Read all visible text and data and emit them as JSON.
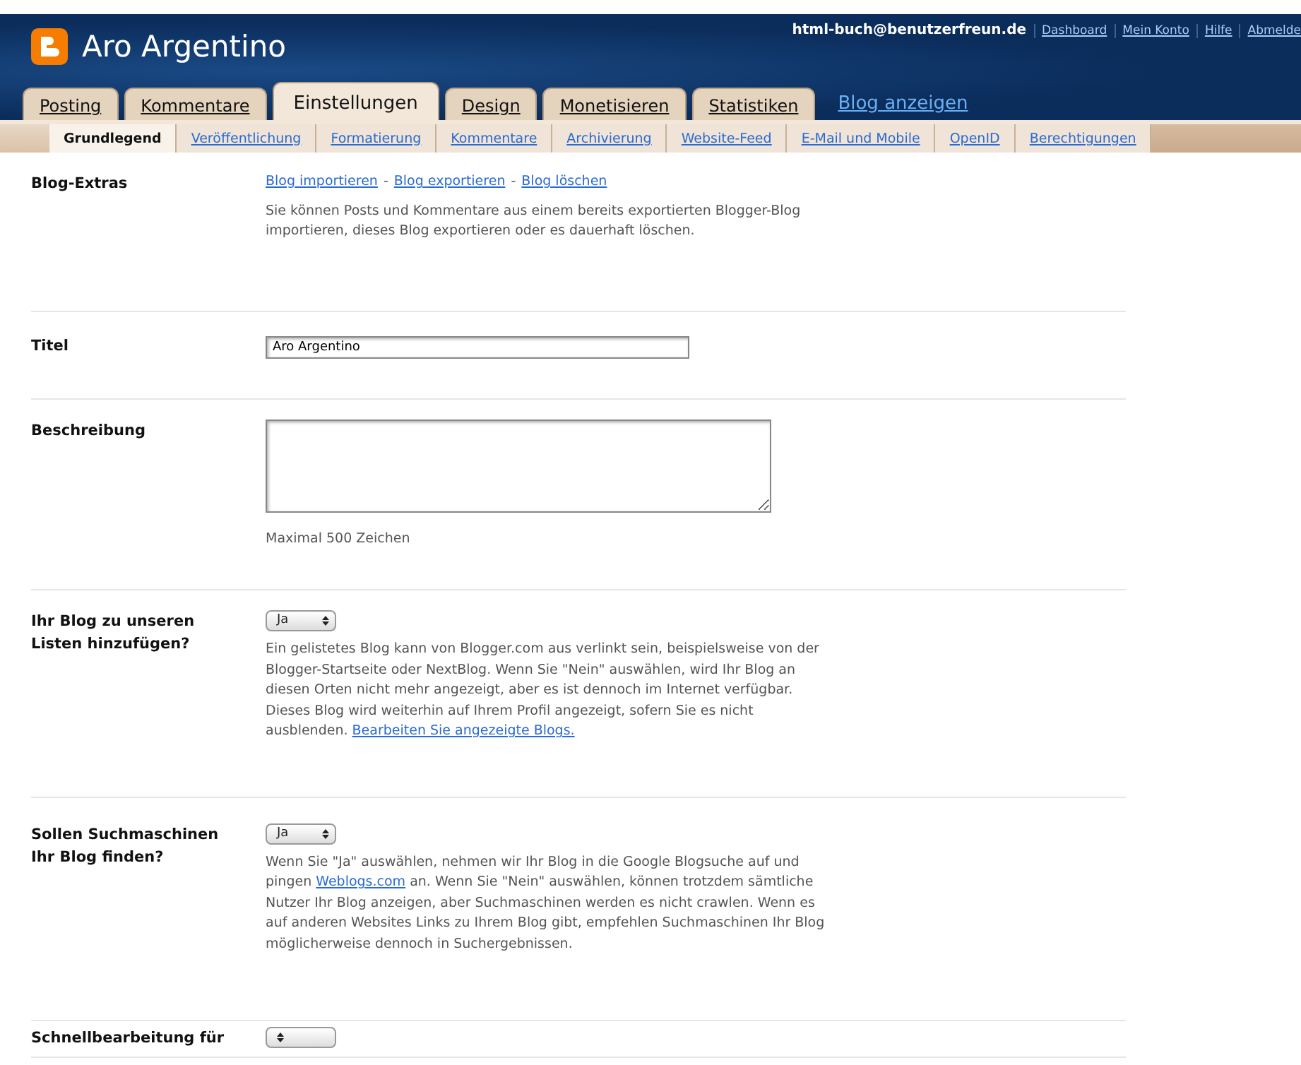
{
  "header": {
    "blog_title": "Aro Argentino",
    "user_email": "html-buch@benutzerfreun.de",
    "links": [
      "Dashboard",
      "Mein Konto",
      "Hilfe",
      "Abmelde"
    ]
  },
  "tabs": [
    {
      "label": "Posting",
      "selected": false
    },
    {
      "label": "Kommentare",
      "selected": false
    },
    {
      "label": "Einstellungen",
      "selected": true
    },
    {
      "label": "Design",
      "selected": false
    },
    {
      "label": "Monetisieren",
      "selected": false
    },
    {
      "label": "Statistiken",
      "selected": false
    }
  ],
  "view_blog_link": "Blog anzeigen",
  "subtabs": [
    {
      "label": "Grundlegend",
      "selected": true
    },
    {
      "label": "Veröffentlichung",
      "selected": false
    },
    {
      "label": "Formatierung",
      "selected": false
    },
    {
      "label": "Kommentare",
      "selected": false
    },
    {
      "label": "Archivierung",
      "selected": false
    },
    {
      "label": "Website-Feed",
      "selected": false
    },
    {
      "label": "E-Mail und Mobile",
      "selected": false
    },
    {
      "label": "OpenID",
      "selected": false
    },
    {
      "label": "Berechtigungen",
      "selected": false
    }
  ],
  "settings": [
    {
      "label": "Blog-Extras",
      "kind": "links",
      "links": [
        "Blog importieren",
        "Blog exportieren",
        "Blog löschen"
      ],
      "link_separator": "-",
      "description": [
        {
          "kind": "text",
          "text": "Sie können Posts und Kommentare aus einem bereits exportierten Blogger-Blog importieren, dieses Blog exportieren oder es dauerhaft löschen."
        }
      ]
    },
    {
      "label": "Titel",
      "kind": "input",
      "value": "Aro Argentino"
    },
    {
      "label": "Beschreibung",
      "kind": "textarea",
      "note": "Maximal 500 Zeichen"
    },
    {
      "label": "Ihr Blog zu unseren Listen hinzufügen?",
      "kind": "select",
      "value": "Ja",
      "description": [
        {
          "kind": "text",
          "text": "Ein gelistetes Blog kann von Blogger.com aus verlinkt sein, beispielsweise von der Blogger-Startseite oder NextBlog. Wenn Sie \"Nein\" auswählen, wird Ihr Blog an diesen Orten nicht mehr angezeigt, aber es ist dennoch im Internet verfügbar. Dieses Blog wird weiterhin auf Ihrem Profil angezeigt, sofern Sie es nicht ausblenden. "
        },
        {
          "kind": "link",
          "text": "Bearbeiten Sie angezeigte Blogs."
        }
      ]
    },
    {
      "label": "Sollen Suchmaschinen Ihr Blog finden?",
      "kind": "select",
      "value": "Ja",
      "description": [
        {
          "kind": "text",
          "text": "Wenn Sie \"Ja\" auswählen, nehmen wir Ihr Blog in die Google Blogsuche auf und pingen "
        },
        {
          "kind": "link",
          "text": "Weblogs.com"
        },
        {
          "kind": "text",
          "text": " an. Wenn Sie \"Nein\" auswählen, können trotzdem sämtliche Nutzer Ihr Blog anzeigen, aber Suchmaschinen werden es nicht crawlen. Wenn es auf anderen Websites Links zu Ihrem Blog gibt, empfehlen Suchmaschinen Ihr Blog möglicherweise dennoch in Suchergebnissen."
        }
      ]
    },
    {
      "label": "Schnellbearbeitung für",
      "kind": "select"
    }
  ]
}
